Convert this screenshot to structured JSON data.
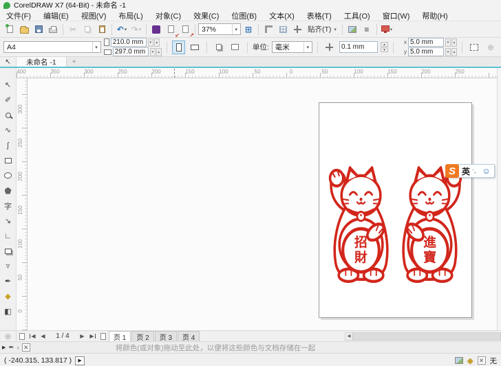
{
  "window": {
    "title": "CorelDRAW X7 (64-Bit) - 未命名 -1"
  },
  "menu": {
    "items": [
      "文件(F)",
      "编辑(E)",
      "视图(V)",
      "布局(L)",
      "对象(C)",
      "效果(C)",
      "位图(B)",
      "文本(X)",
      "表格(T)",
      "工具(O)",
      "窗口(W)",
      "帮助(H)"
    ]
  },
  "toolbar": {
    "zoom_level": "37%",
    "snap_label": "贴齐(T)"
  },
  "property_bar": {
    "paper_type": "A4",
    "paper_width": "210.0 mm",
    "paper_height": "297.0 mm",
    "units_label": "单位:",
    "units_value": "毫米",
    "nudge_distance": "0.1 mm",
    "duplicate_x": "5.0 mm",
    "duplicate_y": "5.0 mm",
    "dup_x_label": "x",
    "dup_y_label": "y"
  },
  "document_tab": {
    "label": "未命名 -1"
  },
  "rulers": {
    "h": [
      "400",
      "350",
      "300",
      "250",
      "200",
      "150",
      "100",
      "50",
      "0",
      "50",
      "100",
      "150",
      "200",
      "250"
    ],
    "v": [
      "300",
      "250",
      "200",
      "150",
      "100",
      "50",
      "0"
    ]
  },
  "canvas": {
    "stamp_color": "#d2261b",
    "coin_left_top": "招",
    "coin_left_bottom": "財",
    "coin_right_top": "進",
    "coin_right_bottom": "寶"
  },
  "navigator": {
    "page_indicator": "1 / 4",
    "tabs": [
      "页 1",
      "页 2",
      "页 3",
      "页 4"
    ]
  },
  "document_palette": {
    "hint": "将颜色(或对象)拖动至此处，以便将这些颜色与文档存储在一起"
  },
  "status_bar": {
    "cursor_position": "( -240.315, 133.817 )",
    "outline_none": "无"
  },
  "ime_bar": {
    "logo_letter": "S",
    "lang_indicator": "英"
  },
  "colors": {
    "accent_teal": "#5bc1d6",
    "stamp_red": "#d2261b",
    "sogou_orange": "#f07a22"
  },
  "icons": {
    "cut": "✂",
    "undo": "↶",
    "redo": "↷",
    "fullscreen": "⊞",
    "menu_lines": "≡",
    "plus_circle": "⊕",
    "pick": "↖",
    "shape": "✐",
    "freehand": "∿",
    "spline": "ʃ",
    "text_tool": "字",
    "dimension": "↘",
    "connector": "∟",
    "transparency": "▿",
    "eyedropper": "✒",
    "fill": "◆",
    "smart_fill": "◧",
    "import_arrow": "↙",
    "export_arrow": "↗",
    "nav_prev": "◀",
    "nav_next": "▶",
    "hscroll_arrow": "◂",
    "flyout": "▶",
    "palette_scroll": "‹",
    "x_mark": "✕",
    "smiley": "☺",
    "arrow_btn": "▶"
  }
}
